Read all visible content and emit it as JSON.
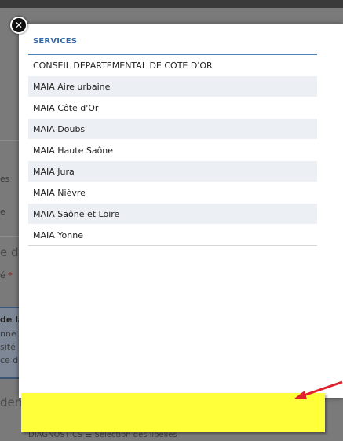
{
  "background": {
    "fragments": [
      "es",
      "e",
      "e de",
      "é",
      "*",
      "de la",
      "nne a",
      "sité d",
      "ce de",
      "dem",
      "DIAGNOSTICS ☰ Sélection des libellés"
    ]
  },
  "modal": {
    "close_icon": "close-icon",
    "header": "SERVICES",
    "services": [
      "CONSEIL DEPARTEMENTAL DE COTE D'OR",
      "MAIA Aire urbaine",
      "MAIA Côte d'Or",
      "MAIA Doubs",
      "MAIA Haute Saône",
      "MAIA Jura",
      "MAIA Nièvre",
      "MAIA Saône et Loire",
      "MAIA Yonne"
    ]
  },
  "annotation": {
    "highlight_color": "#ffff3a",
    "arrow_color": "#e0202a"
  }
}
